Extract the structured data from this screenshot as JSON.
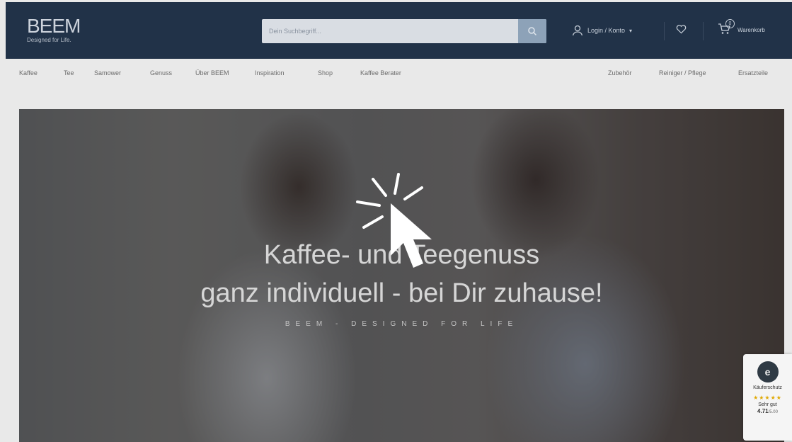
{
  "header": {
    "logo": "BEEM",
    "logo_sub": "Designed for Life.",
    "search_placeholder": "Dein Suchbegriff...",
    "login_label": "Login / Konto",
    "cart_label": "Warenkorb",
    "cart_count": "0"
  },
  "nav": {
    "left": [
      "Kaffee",
      "Tee",
      "Samower",
      "Genuss",
      "Über BEEM",
      "Inspiration",
      "Shop",
      "Kaffee Berater"
    ],
    "right": [
      "Zubehör",
      "Reiniger / Pflege",
      "Ersatzteile"
    ]
  },
  "hero": {
    "headline_1": "Kaffee- und Teegenuss",
    "headline_2": "ganz individuell - bei Dir zuhause!",
    "tagline": "BEEM - DESIGNED FOR LIFE"
  },
  "trust_badge": {
    "label": "Käuferschutz",
    "stars": "★★★★★",
    "rating_text": "Sehr gut",
    "score": "4.71",
    "max": "/5.00"
  },
  "colors": {
    "header_bg": "#213248",
    "search_button": "#8da2b8"
  }
}
